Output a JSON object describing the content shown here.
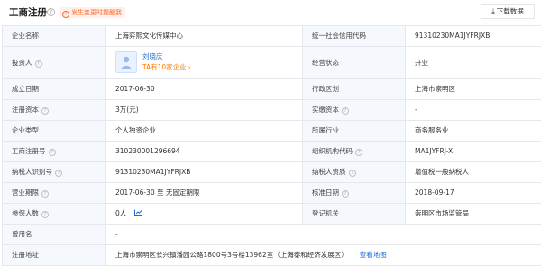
{
  "header": {
    "title": "工商注册",
    "help_icon": "help-circle-icon",
    "alert_label": "发生变更时提醒我",
    "alert_icon": "alert-circle-icon",
    "download_label": "下载数据",
    "download_icon": "download-arrow-icon"
  },
  "rows": {
    "name_label": "企业名称",
    "name_value": "上海弈熙文化传媒中心",
    "credit_label": "统一社会信用代码",
    "credit_value": "91310230MA1JYFRJXB",
    "investor_label": "投资人",
    "investor_name": "刘晓庆",
    "investor_companies": "TA有10家企业",
    "investor_arrow": "›",
    "status_label": "经营状态",
    "status_value": "开业",
    "founded_label": "成立日期",
    "founded_value": "2017-06-30",
    "region_label": "行政区划",
    "region_value": "上海市崇明区",
    "capital_label": "注册资本",
    "capital_value": "3万(元)",
    "paid_label": "实缴资本",
    "paid_value": "-",
    "type_label": "企业类型",
    "type_value": "个人独资企业",
    "industry_label": "所属行业",
    "industry_value": "商务服务业",
    "regno_label": "工商注册号",
    "regno_value": "310230001296694",
    "orgcode_label": "组织机构代码",
    "orgcode_value": "MA1JYFRJ-X",
    "taxid_label": "纳税人识别号",
    "taxid_value": "91310230MA1JYFRJXB",
    "taxqual_label": "纳税人资质",
    "taxqual_value": "增值税一般纳税人",
    "term_label": "营业期限",
    "term_value": "2017-06-30 至 无固定期限",
    "approve_label": "核准日期",
    "approve_value": "2018-09-17",
    "insured_label": "参保人数",
    "insured_value": "0人",
    "regauth_label": "登记机关",
    "regauth_value": "崇明区市场监管局",
    "former_label": "曾用名",
    "former_value": "-",
    "address_label": "注册地址",
    "address_value": "上海市崇明区长兴镇潘园公路1800号3号楼13962室（上海泰和经济发展区）",
    "address_link": "查看地图"
  }
}
